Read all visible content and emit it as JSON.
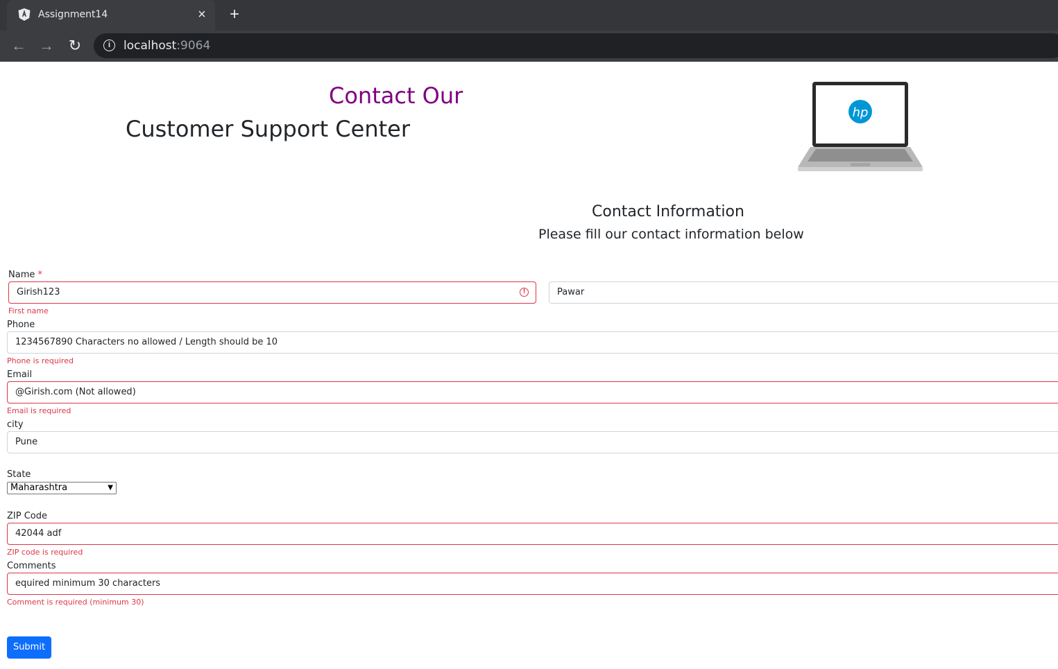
{
  "browser": {
    "tab_title": "Assignment14",
    "url_host": "localhost",
    "url_port": ":9064"
  },
  "header": {
    "line1": "Contact Our",
    "line2": "Customer Support Center",
    "laptop_logo": "hp"
  },
  "section": {
    "title": "Contact Information",
    "subtitle": "Please fill our contact information below"
  },
  "form": {
    "name_label": "Name",
    "name_required_mark": "*",
    "first_name_value": "Girish123",
    "last_name_value": "Pawar",
    "first_name_error": "First name",
    "phone_label": "Phone",
    "phone_value": "1234567890 Characters no allowed / Length should be 10",
    "phone_error": "Phone is required",
    "email_label": "Email",
    "email_value": "@Girish.com (Not allowed)",
    "email_error": "Email is required",
    "city_label": "city",
    "city_value": "Pune",
    "state_label": "State",
    "state_value": "Maharashtra",
    "zip_label": "ZIP Code",
    "zip_value": "42044  adf",
    "zip_error": "ZIP code is required",
    "comments_label": "Comments",
    "comments_value": "equired minimum 30 characters",
    "comments_error": "Comment is required (minimum 30)",
    "submit_label": "Submit"
  },
  "colors": {
    "accent_purple": "#800080",
    "error_red": "#dc3545",
    "primary_blue": "#0d6efd"
  }
}
